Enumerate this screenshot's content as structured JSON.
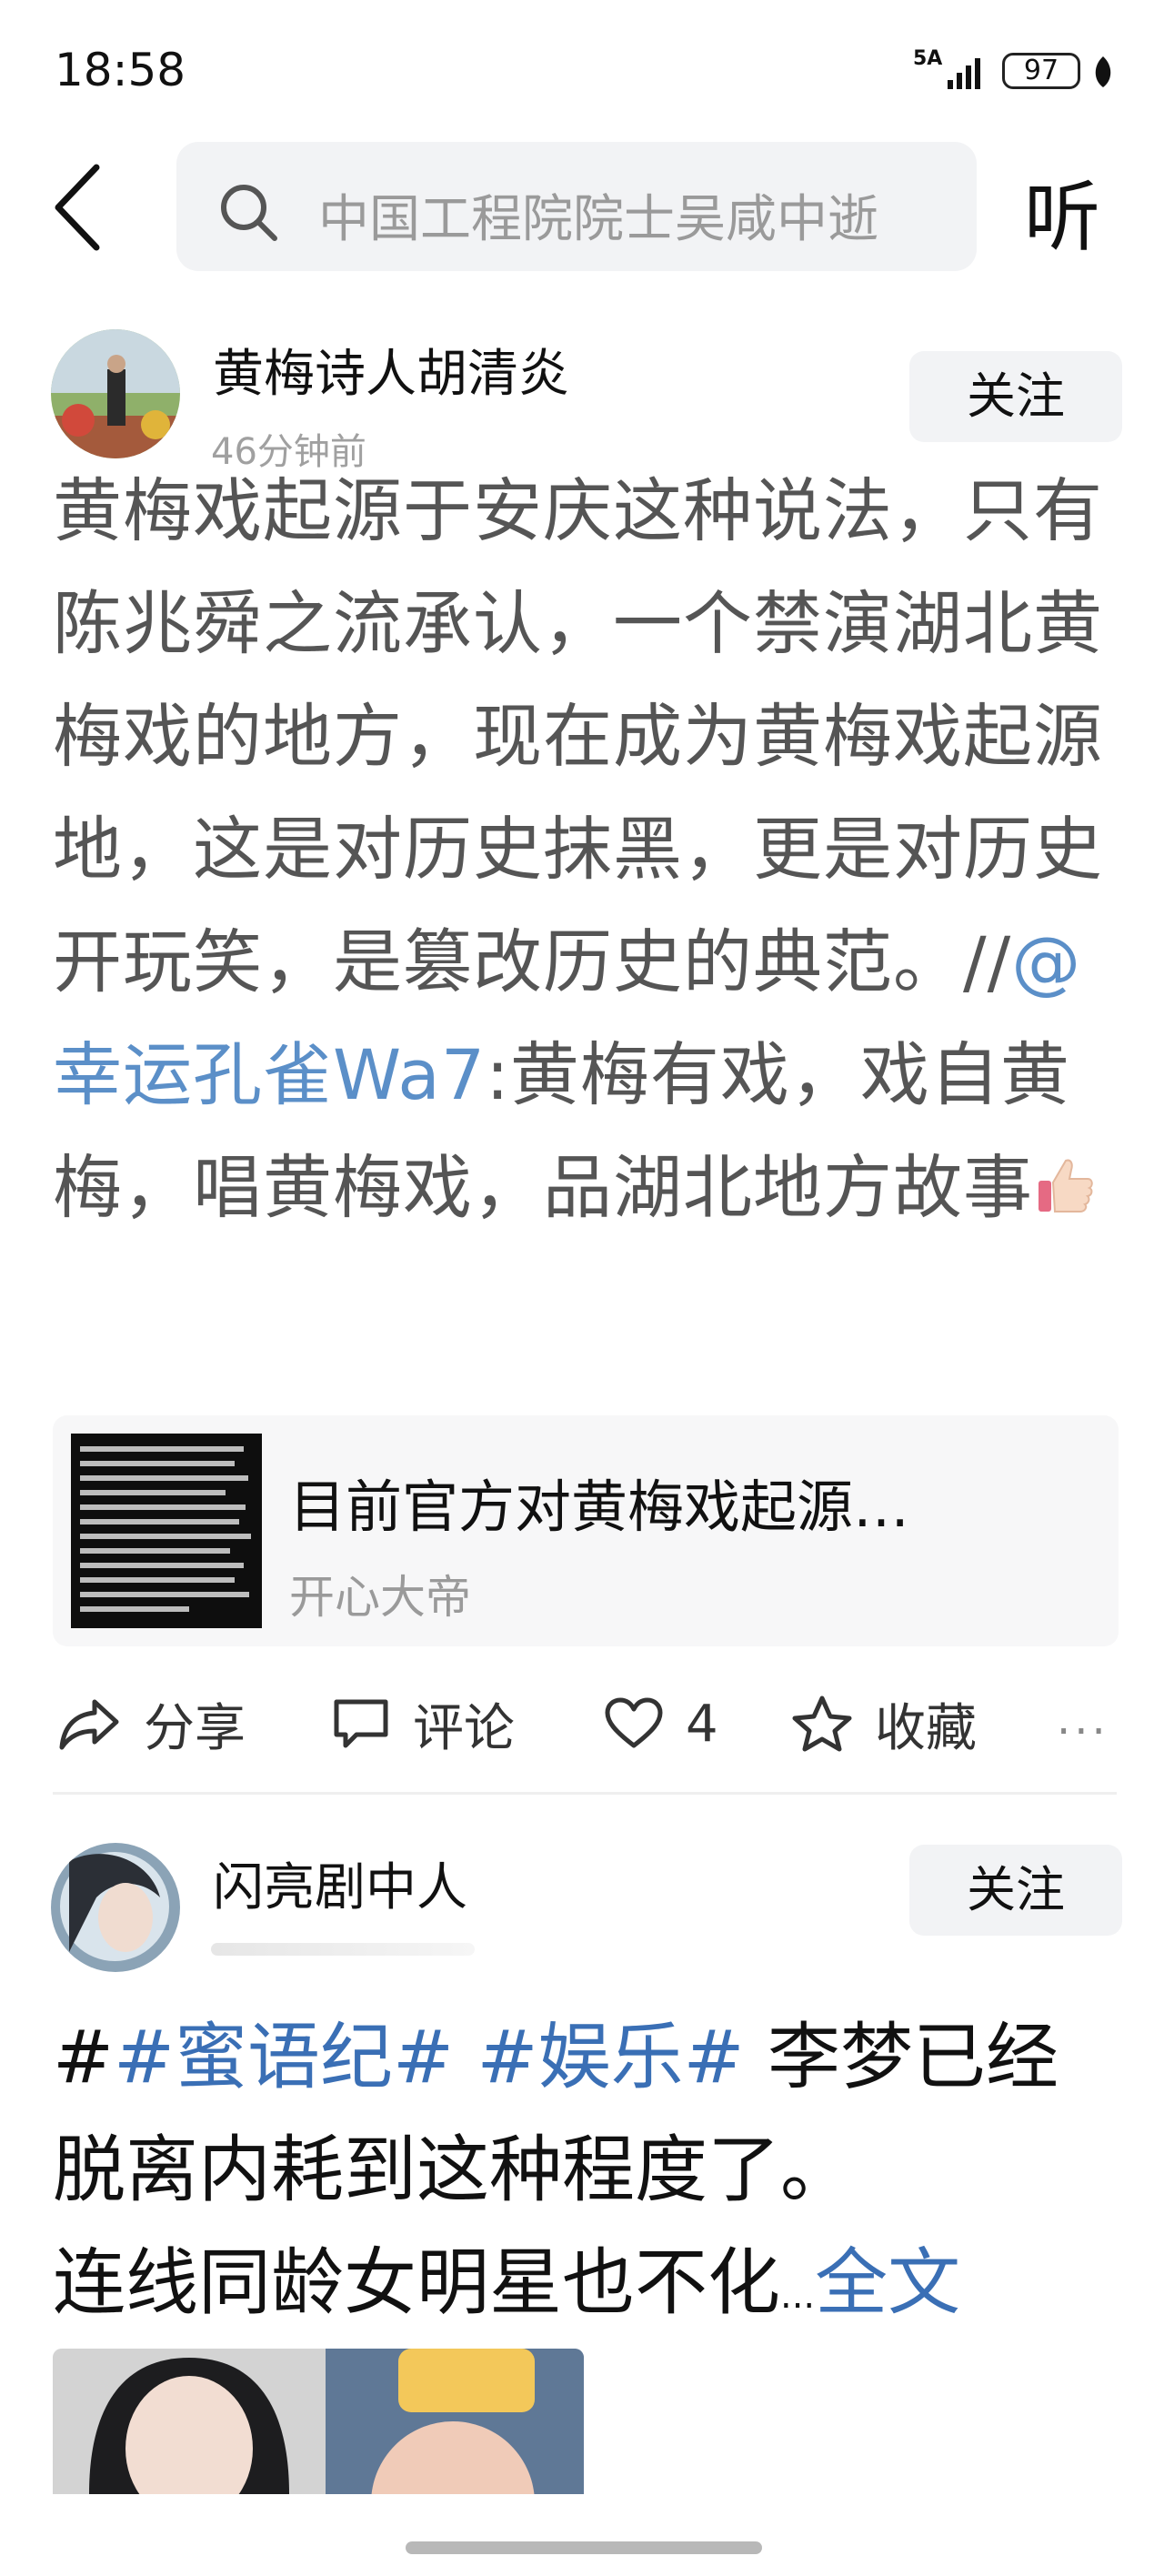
{
  "status_bar": {
    "time": "18:58",
    "network": "5A",
    "battery": "97"
  },
  "search": {
    "placeholder": "中国工程院院士吴咸中逝"
  },
  "listen_label": "听",
  "post1": {
    "author": "黄梅诗人胡清炎",
    "time": "46分钟前",
    "follow_label": "关注",
    "text_before": "黄梅戏起源于安庆这种说法，只有陈兆舜之流承认，一个禁演湖北黄梅戏的地方，现在成为黄梅戏起源地，这是对历史抹黑，更是对历史开玩笑，是篡改历史的典范。//",
    "mention": "@幸运孔雀Wa7",
    "text_after": ":黄梅有戏，戏自黄梅，唱黄梅戏，品湖北地方故事",
    "card": {
      "title": "目前官方对黄梅戏起源…",
      "source": "开心大帝"
    },
    "actions": {
      "share": "分享",
      "comment": "评论",
      "like_count": "4",
      "favorite": "收藏",
      "more": "···"
    }
  },
  "post2": {
    "author": "闪亮剧中人",
    "follow_label": "关注",
    "hash_prefix": "#",
    "tag1": "#蜜语纪#",
    "tag2": "#娱乐#",
    "text_line1_rest": " 李梦已经脱离内耗到这种程度了。",
    "text_line2": "连线同龄女明星也不化",
    "ellipsis": "...",
    "full_text": "全文"
  }
}
